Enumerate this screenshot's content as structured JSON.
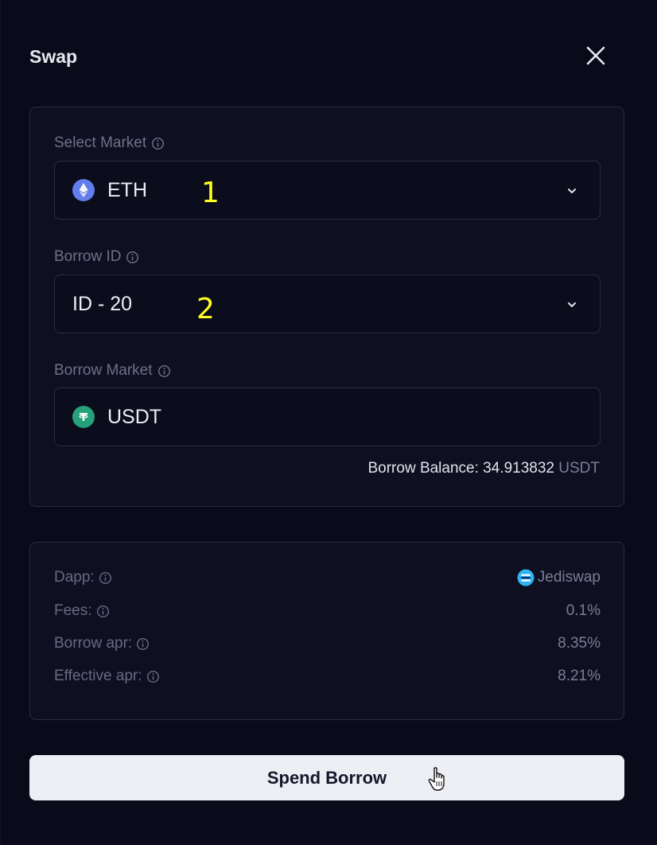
{
  "modal": {
    "title": "Swap"
  },
  "form": {
    "select_market_label": "Select Market",
    "select_market_value": "ETH",
    "borrow_id_label": "Borrow ID",
    "borrow_id_value": "ID - 20",
    "borrow_market_label": "Borrow Market",
    "borrow_market_value": "USDT",
    "balance_label": "Borrow Balance: 34.913832",
    "balance_unit": "USDT"
  },
  "details": {
    "rows": [
      {
        "label": "Dapp:",
        "value": "Jediswap"
      },
      {
        "label": "Fees:",
        "value": "0.1%"
      },
      {
        "label": "Borrow apr:",
        "value": "8.35%"
      },
      {
        "label": "Effective apr:",
        "value": "8.21%"
      }
    ]
  },
  "action": {
    "button_label": "Spend Borrow"
  },
  "annotations": {
    "marker_1": "1",
    "marker_2": "2"
  },
  "colors": {
    "eth_coin": "#627eea",
    "usdt_coin": "#26a17b",
    "annotation": "#ffff1e"
  },
  "icons": [
    "close-icon",
    "info-icon",
    "eth-icon",
    "usdt-icon",
    "chevron-down-icon",
    "jediswap-logo",
    "hand-cursor-icon"
  ]
}
